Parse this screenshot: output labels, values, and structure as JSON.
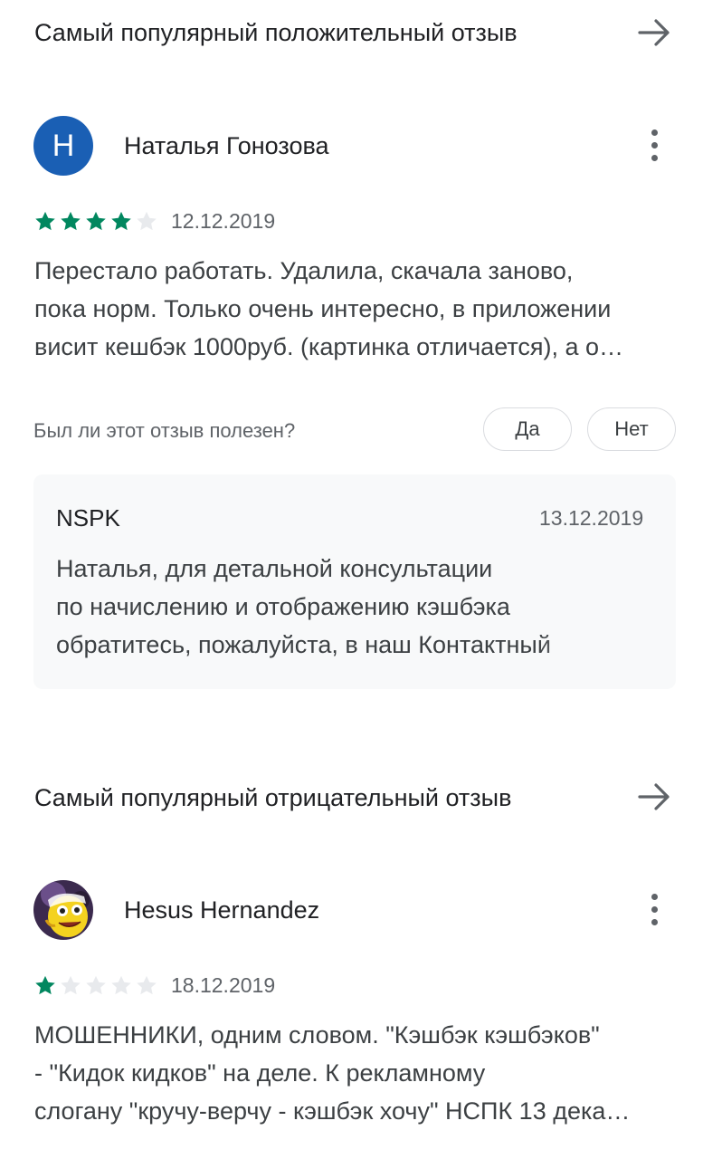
{
  "positive": {
    "section_title": "Самый популярный положительный отзыв",
    "avatar_letter": "Н",
    "avatar_color": "#1a5fb4",
    "author": "Наталья Гонозова",
    "rating": 4,
    "rating_max": 5,
    "date": "12.12.2019",
    "text": "Перестало работать. Удалила, скачала заново,\nпока норм. Только очень интересно, в приложении\nвисит кешбэк 1000руб. (картинка отличается), а о…",
    "helpful_question": "Был ли этот отзыв полезен?",
    "helpful_yes": "Да",
    "helpful_no": "Нет",
    "reply": {
      "author": "NSPK",
      "date": "13.12.2019",
      "text": "Наталья, для детальной консультации\nпо начислению и отображению кэшбэка\nобратитесь, пожалуйста, в наш Контактный"
    }
  },
  "negative": {
    "section_title": "Самый популярный отрицательный отзыв",
    "author": "Hesus Hernandez",
    "rating": 1,
    "rating_max": 5,
    "date": "18.12.2019",
    "text": "МОШЕННИКИ, одним словом. \"Кэшбэк кэшбэков\"\n- \"Кидок кидков\" на деле. К рекламному\nслогану \"кручу-верчу - кэшбэк хочу\" НСПК 13 дека…"
  },
  "icons": {
    "section_arrow": "arrow-right-icon",
    "more": "more-vert-icon",
    "star": "star-icon"
  },
  "colors": {
    "star_filled": "#01875f",
    "star_empty": "#e8eaed",
    "text_secondary": "#5f6368"
  }
}
